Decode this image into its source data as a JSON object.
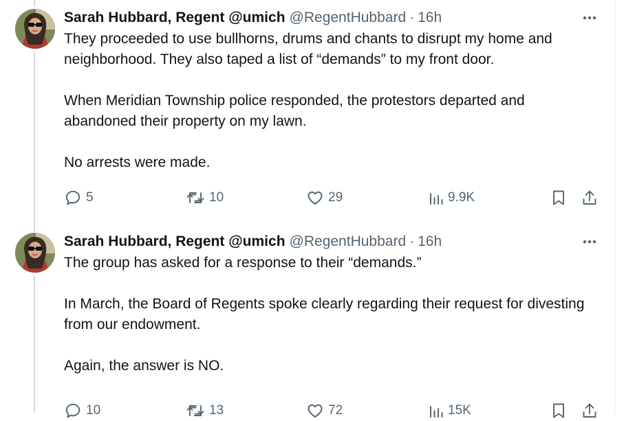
{
  "tweets": [
    {
      "author_name": "Sarah Hubbard, Regent @umich",
      "handle": "@RegentHubbard",
      "separator": "·",
      "time": "16h",
      "paragraphs": [
        "They proceeded to use bullhorns, drums and chants to disrupt my home and neighborhood.  They also taped a list of “demands” to my front door.",
        "When Meridian Township police responded, the protestors departed and abandoned their property on my lawn.",
        "No arrests were made."
      ],
      "replies": "5",
      "retweets": "10",
      "likes": "29",
      "views": "9.9K"
    },
    {
      "author_name": "Sarah Hubbard, Regent @umich",
      "handle": "@RegentHubbard",
      "separator": "·",
      "time": "16h",
      "paragraphs": [
        "The group has asked for a response to their “demands.”",
        "In March, the Board of Regents spoke clearly regarding their request for divesting from our endowment.",
        "Again, the answer is NO."
      ],
      "replies": "10",
      "retweets": "13",
      "likes": "72",
      "views": "15K"
    }
  ],
  "icons": {
    "reply": "reply-icon",
    "retweet": "retweet-icon",
    "like": "heart-icon",
    "views": "views-icon",
    "bookmark": "bookmark-icon",
    "share": "share-icon",
    "more": "more-icon"
  },
  "colors": {
    "text": "#0f1419",
    "secondary": "#536471",
    "thread_line": "#cfd9de"
  }
}
